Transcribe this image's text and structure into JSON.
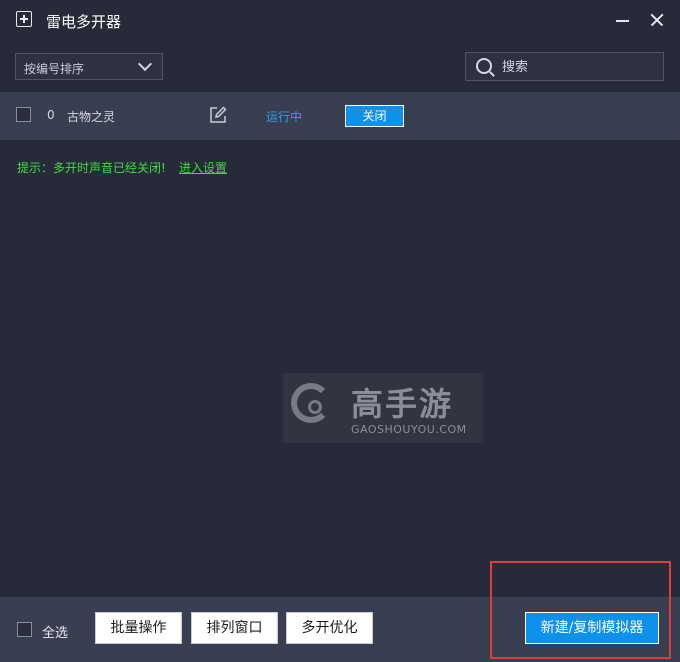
{
  "app": {
    "title": "雷电多开器"
  },
  "toolbar": {
    "sort_label": "按编号排序",
    "search_placeholder": "搜索"
  },
  "instances": [
    {
      "index": "0",
      "name": "古物之灵",
      "status": "运行中",
      "action_label": "关闭"
    }
  ],
  "hint": {
    "text": "提示：多开时声音已经关闭!",
    "link": "进入设置"
  },
  "watermark": {
    "name_cn": "高手游",
    "domain": "GAOSHOUYOU.COM"
  },
  "footer": {
    "select_all_label": "全选",
    "batch_label": "批量操作",
    "arrange_label": "排列窗口",
    "optimize_label": "多开优化",
    "new_label": "新建/复制模拟器"
  },
  "colors": {
    "accent": "#0d91ea",
    "status_running": "#2e9ee8",
    "hint_green": "#3fdc3f",
    "highlight_red": "#e23b3b"
  }
}
